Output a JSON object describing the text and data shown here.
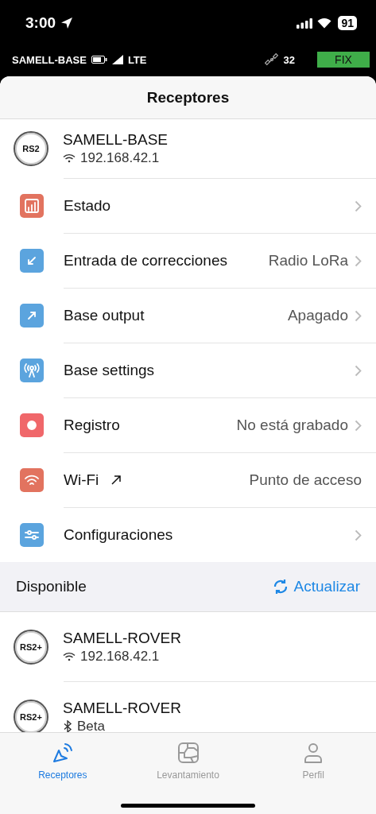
{
  "status_bar": {
    "time": "3:00",
    "battery": "91"
  },
  "receiver_bar": {
    "name": "SAMELL-BASE",
    "network": "LTE",
    "satellites": "32",
    "solution": "FIX"
  },
  "title": "Receptores",
  "connected": {
    "model": "RS2",
    "name": "SAMELL-BASE",
    "kind": "wifi",
    "detail": "192.168.42.1"
  },
  "menu": [
    {
      "kind": "chart",
      "color": "#e2735f",
      "label": "Estado",
      "external": false,
      "chevron": true
    },
    {
      "kind": "arrow-in",
      "color": "#5ba4de",
      "label": "Entrada de correcciones",
      "external": false,
      "value": "Radio LoRa",
      "chevron": true
    },
    {
      "kind": "arrow-out",
      "color": "#5ba4de",
      "label": "Base output",
      "external": false,
      "value": "Apagado",
      "chevron": true
    },
    {
      "kind": "antenna",
      "color": "#5ba4de",
      "label": "Base settings",
      "external": false,
      "chevron": true
    },
    {
      "kind": "record",
      "color": "#f0676a",
      "label": "Registro",
      "external": false,
      "value": "No está grabado",
      "chevron": true
    },
    {
      "kind": "wifi",
      "color": "#e2735f",
      "label": "Wi-Fi",
      "external": true,
      "value": "Punto de acceso",
      "chevron": false
    },
    {
      "kind": "sliders",
      "color": "#5ba4de",
      "label": "Configuraciones",
      "external": false,
      "chevron": true
    }
  ],
  "available": {
    "title": "Disponible",
    "refresh": "Actualizar",
    "devices": [
      {
        "model": "RS2+",
        "name": "SAMELL-ROVER",
        "kind": "wifi",
        "detail": "192.168.42.1"
      },
      {
        "model": "RS2+",
        "name": "SAMELL-ROVER",
        "kind": "bluetooth",
        "detail": "Beta"
      }
    ]
  },
  "tabs": [
    {
      "kind": "receivers",
      "label": "Receptores",
      "selected": true
    },
    {
      "kind": "survey",
      "label": "Levantamiento",
      "selected": false
    },
    {
      "kind": "profile",
      "label": "Perfil",
      "selected": false
    }
  ]
}
